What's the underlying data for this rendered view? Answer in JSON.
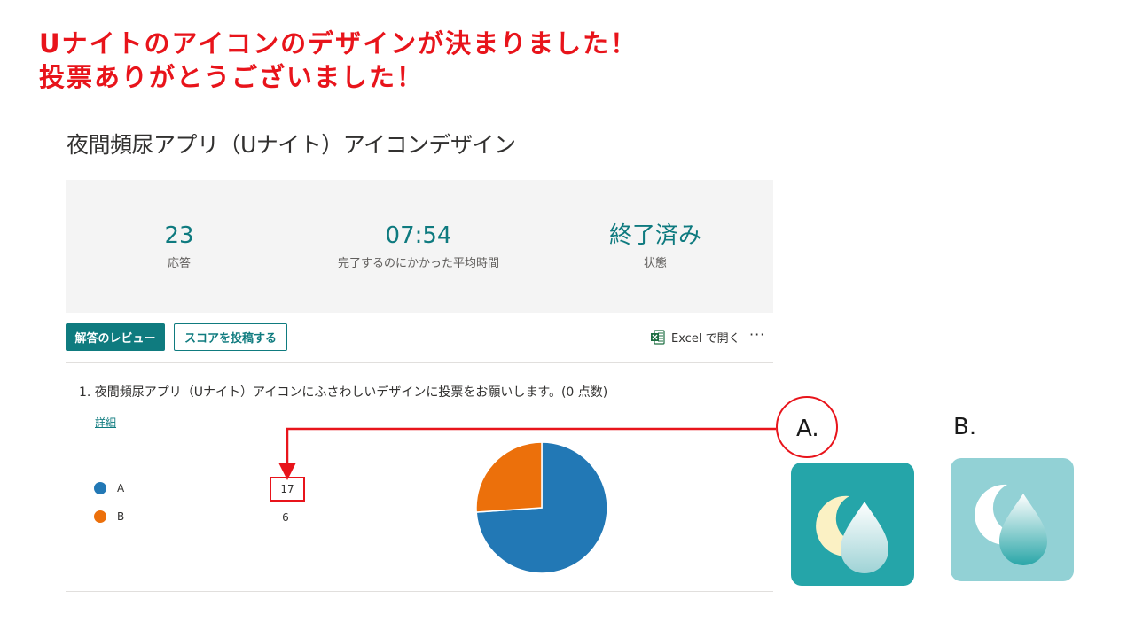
{
  "announcement": {
    "line1": "Uナイトのアイコンのデザインが決まりました！",
    "line2": "投票ありがとうございました！"
  },
  "form": {
    "title": "夜間頻尿アプリ（Uナイト）アイコンデザイン"
  },
  "summary": {
    "responses": {
      "value": "23",
      "label": "応答"
    },
    "avg_time": {
      "value": "07:54",
      "label": "完了するのにかかった平均時間"
    },
    "status": {
      "value": "終了済み",
      "label": "状態"
    }
  },
  "toolbar": {
    "review_label": "解答のレビュー",
    "score_label": "スコアを投稿する",
    "excel_label": "Excel で開く",
    "more_label": "···"
  },
  "question": {
    "text": "1.  夜間頻尿アプリ（Uナイト）アイコンにふさわしいデザインに投票をお願いします。(0 点数)",
    "details_link": "詳細"
  },
  "chart_data": {
    "type": "pie",
    "categories": [
      "A",
      "B"
    ],
    "values": [
      17,
      6
    ],
    "colors": [
      "#2278b5",
      "#ec700b"
    ]
  },
  "options": {
    "a_label": "A.",
    "b_label": "B."
  },
  "colors": {
    "accent": "#0f7b7f",
    "highlight_red": "#e8141b"
  }
}
